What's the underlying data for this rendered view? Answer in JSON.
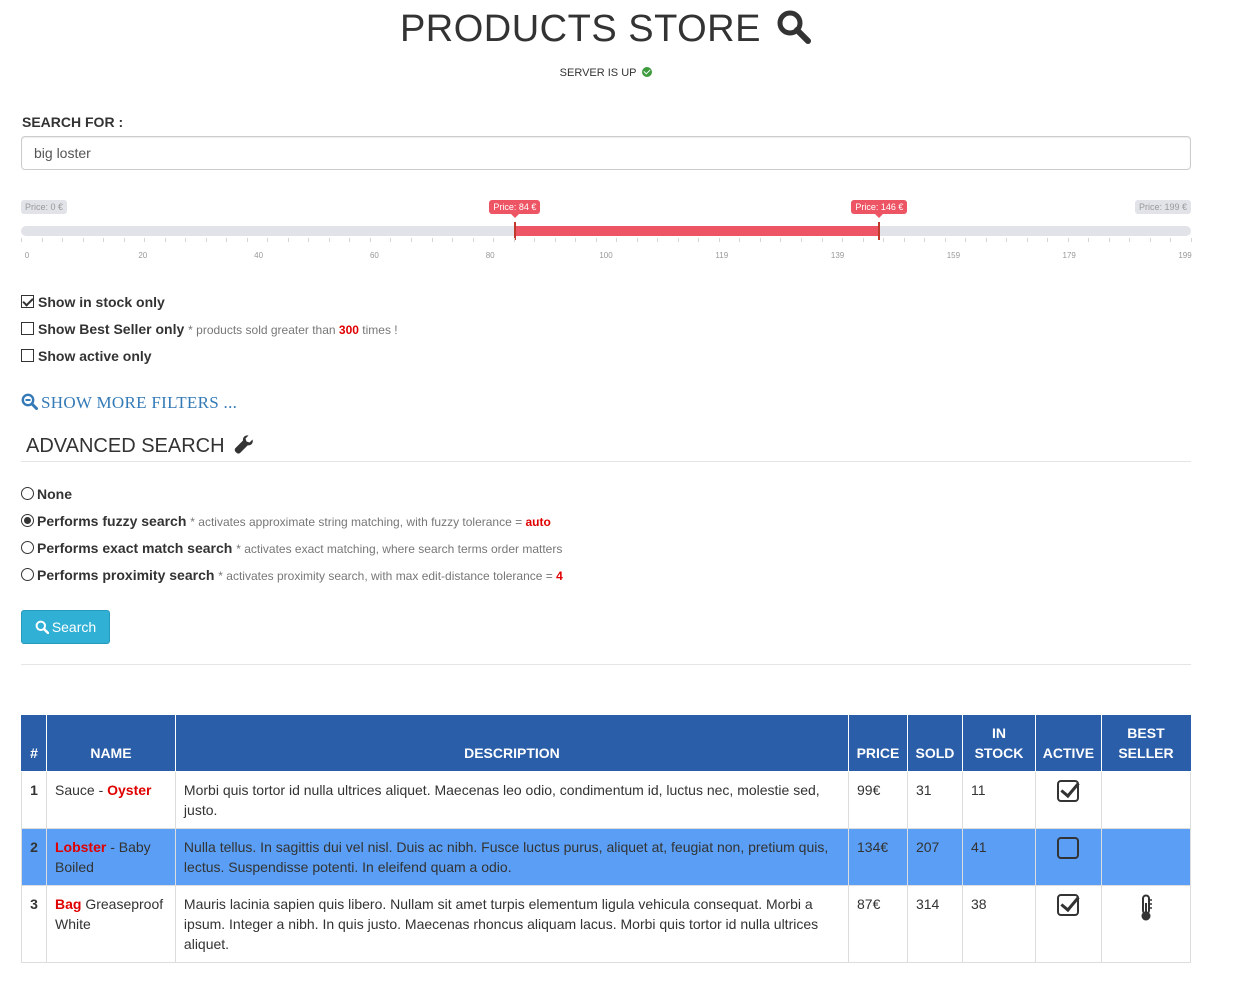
{
  "header": {
    "title": "PRODUCTS STORE",
    "server_status": "SERVER IS UP"
  },
  "search": {
    "label": "SEARCH FOR :",
    "value": "big loster"
  },
  "price_slider": {
    "min_label": "Price: 0 €",
    "max_label": "Price: 199 €",
    "low_label": "Price: 84 €",
    "high_label": "Price: 146 €",
    "min": 0,
    "max": 199,
    "low": 84,
    "high": 146,
    "ticks": [
      "0",
      "20",
      "40",
      "60",
      "80",
      "100",
      "119",
      "139",
      "159",
      "179",
      "199"
    ]
  },
  "filters": [
    {
      "label": "Show in stock only",
      "checked": true,
      "note": "",
      "note_value": "",
      "note_suffix": ""
    },
    {
      "label": "Show Best Seller only",
      "checked": false,
      "note": "* products sold greater than",
      "note_value": "300",
      "note_suffix": "times !"
    },
    {
      "label": "Show active only",
      "checked": false,
      "note": "",
      "note_value": "",
      "note_suffix": ""
    }
  ],
  "more_filters_label": "SHOW MORE FILTERS ...",
  "advanced": {
    "title": "ADVANCED SEARCH",
    "options": [
      {
        "label": "None",
        "checked": false,
        "note": "",
        "value": ""
      },
      {
        "label": "Performs fuzzy search",
        "checked": true,
        "note": "* activates approximate string matching, with fuzzy tolerance =",
        "value": "auto"
      },
      {
        "label": "Performs exact match search",
        "checked": false,
        "note": "* activates exact matching, where search terms order matters",
        "value": ""
      },
      {
        "label": "Performs proximity search",
        "checked": false,
        "note": "* activates proximity search, with max edit-distance tolerance =",
        "value": "4"
      }
    ]
  },
  "search_button": "Search",
  "table": {
    "headers": [
      "#",
      "NAME",
      "DESCRIPTION",
      "PRICE",
      "SOLD",
      "IN STOCK",
      "ACTIVE",
      "BEST SELLER"
    ],
    "rows": [
      {
        "idx": "1",
        "name_pre": "Sauce - ",
        "name_hl": "Oyster",
        "name_post": "",
        "description": "Morbi quis tortor id nulla ultrices aliquet. Maecenas leo odio, condimentum id, luctus nec, molestie sed, justo.",
        "price": "99€",
        "sold": "31",
        "stock": "11",
        "active": true,
        "best_seller": false,
        "highlight": false
      },
      {
        "idx": "2",
        "name_pre": "",
        "name_hl": "Lobster",
        "name_post": " - Baby Boiled",
        "description": "Nulla tellus. In sagittis dui vel nisl. Duis ac nibh. Fusce luctus purus, aliquet at, feugiat non, pretium quis, lectus. Suspendisse potenti. In eleifend quam a odio.",
        "price": "134€",
        "sold": "207",
        "stock": "41",
        "active": false,
        "best_seller": false,
        "highlight": true
      },
      {
        "idx": "3",
        "name_pre": "",
        "name_hl": "Bag",
        "name_post": " Greaseproof White",
        "description": "Mauris lacinia sapien quis libero. Nullam sit amet turpis elementum ligula vehicula consequat. Morbi a ipsum. Integer a nibh. In quis justo. Maecenas rhoncus aliquam lacus. Morbi quis tortor id nulla ultrices aliquet.",
        "price": "87€",
        "sold": "314",
        "stock": "38",
        "active": true,
        "best_seller": true,
        "highlight": false
      }
    ]
  },
  "colors": {
    "slider_range": "#ed5565",
    "table_header": "#2a5ea8",
    "row_highlight": "#5a9ff5",
    "search_button": "#31b0d5",
    "match_highlight": "#e00000"
  }
}
